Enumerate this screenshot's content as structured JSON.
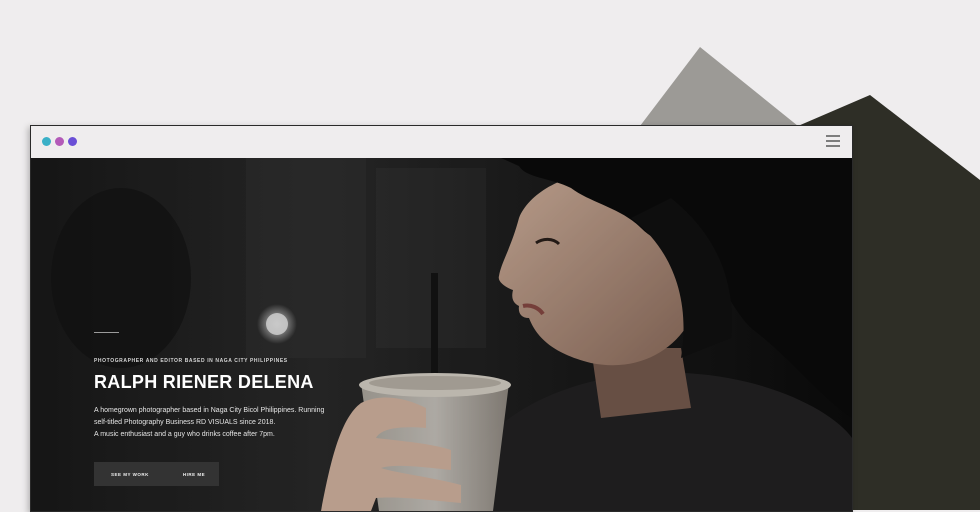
{
  "colors": {
    "page_bg": "#efedee",
    "mountain_light": "#9c9a96",
    "mountain_dark": "#2e2e26",
    "dot_1": "#3ab0c7",
    "dot_2": "#b35ab8",
    "dot_3": "#6a4fd6"
  },
  "window": {
    "traffic_dots": [
      "dot-1",
      "dot-2",
      "dot-3"
    ],
    "menu_icon": "hamburger-menu-icon"
  },
  "hero": {
    "kicker": "PHOTOGRAPHER AND EDITOR BASED IN NAGA CITY PHILIPPINES",
    "name": "RALPH RIENER DELENA",
    "bio_lines": [
      "A homegrown photographer based in Naga City Bicol Philippines. Running",
      "self-titled Photography Business RD VISUALS since 2018.",
      "A music enthusiast and a guy who drinks coffee after 7pm."
    ],
    "buttons": {
      "see_work": "SEE MY WORK",
      "hire_me": "HIRE ME"
    }
  }
}
